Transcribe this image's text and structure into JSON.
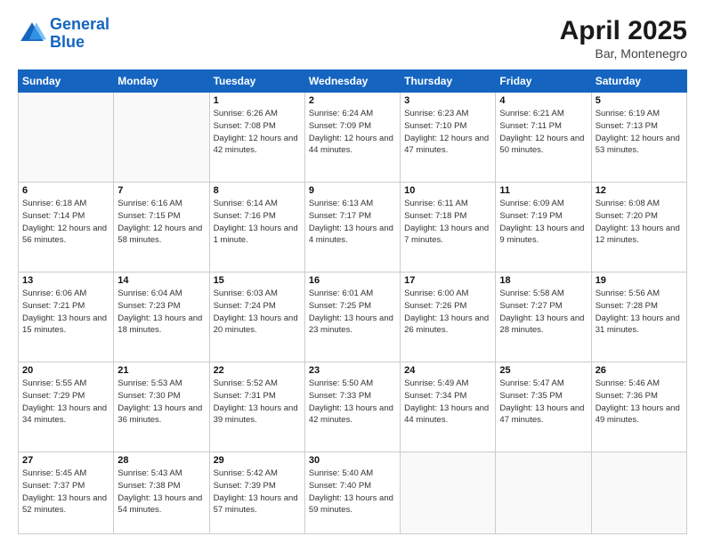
{
  "header": {
    "logo_general": "General",
    "logo_blue": "Blue",
    "month": "April 2025",
    "location": "Bar, Montenegro"
  },
  "weekdays": [
    "Sunday",
    "Monday",
    "Tuesday",
    "Wednesday",
    "Thursday",
    "Friday",
    "Saturday"
  ],
  "weeks": [
    [
      {
        "day": "",
        "sunrise": "",
        "sunset": "",
        "daylight": ""
      },
      {
        "day": "",
        "sunrise": "",
        "sunset": "",
        "daylight": ""
      },
      {
        "day": "1",
        "sunrise": "Sunrise: 6:26 AM",
        "sunset": "Sunset: 7:08 PM",
        "daylight": "Daylight: 12 hours and 42 minutes."
      },
      {
        "day": "2",
        "sunrise": "Sunrise: 6:24 AM",
        "sunset": "Sunset: 7:09 PM",
        "daylight": "Daylight: 12 hours and 44 minutes."
      },
      {
        "day": "3",
        "sunrise": "Sunrise: 6:23 AM",
        "sunset": "Sunset: 7:10 PM",
        "daylight": "Daylight: 12 hours and 47 minutes."
      },
      {
        "day": "4",
        "sunrise": "Sunrise: 6:21 AM",
        "sunset": "Sunset: 7:11 PM",
        "daylight": "Daylight: 12 hours and 50 minutes."
      },
      {
        "day": "5",
        "sunrise": "Sunrise: 6:19 AM",
        "sunset": "Sunset: 7:13 PM",
        "daylight": "Daylight: 12 hours and 53 minutes."
      }
    ],
    [
      {
        "day": "6",
        "sunrise": "Sunrise: 6:18 AM",
        "sunset": "Sunset: 7:14 PM",
        "daylight": "Daylight: 12 hours and 56 minutes."
      },
      {
        "day": "7",
        "sunrise": "Sunrise: 6:16 AM",
        "sunset": "Sunset: 7:15 PM",
        "daylight": "Daylight: 12 hours and 58 minutes."
      },
      {
        "day": "8",
        "sunrise": "Sunrise: 6:14 AM",
        "sunset": "Sunset: 7:16 PM",
        "daylight": "Daylight: 13 hours and 1 minute."
      },
      {
        "day": "9",
        "sunrise": "Sunrise: 6:13 AM",
        "sunset": "Sunset: 7:17 PM",
        "daylight": "Daylight: 13 hours and 4 minutes."
      },
      {
        "day": "10",
        "sunrise": "Sunrise: 6:11 AM",
        "sunset": "Sunset: 7:18 PM",
        "daylight": "Daylight: 13 hours and 7 minutes."
      },
      {
        "day": "11",
        "sunrise": "Sunrise: 6:09 AM",
        "sunset": "Sunset: 7:19 PM",
        "daylight": "Daylight: 13 hours and 9 minutes."
      },
      {
        "day": "12",
        "sunrise": "Sunrise: 6:08 AM",
        "sunset": "Sunset: 7:20 PM",
        "daylight": "Daylight: 13 hours and 12 minutes."
      }
    ],
    [
      {
        "day": "13",
        "sunrise": "Sunrise: 6:06 AM",
        "sunset": "Sunset: 7:21 PM",
        "daylight": "Daylight: 13 hours and 15 minutes."
      },
      {
        "day": "14",
        "sunrise": "Sunrise: 6:04 AM",
        "sunset": "Sunset: 7:23 PM",
        "daylight": "Daylight: 13 hours and 18 minutes."
      },
      {
        "day": "15",
        "sunrise": "Sunrise: 6:03 AM",
        "sunset": "Sunset: 7:24 PM",
        "daylight": "Daylight: 13 hours and 20 minutes."
      },
      {
        "day": "16",
        "sunrise": "Sunrise: 6:01 AM",
        "sunset": "Sunset: 7:25 PM",
        "daylight": "Daylight: 13 hours and 23 minutes."
      },
      {
        "day": "17",
        "sunrise": "Sunrise: 6:00 AM",
        "sunset": "Sunset: 7:26 PM",
        "daylight": "Daylight: 13 hours and 26 minutes."
      },
      {
        "day": "18",
        "sunrise": "Sunrise: 5:58 AM",
        "sunset": "Sunset: 7:27 PM",
        "daylight": "Daylight: 13 hours and 28 minutes."
      },
      {
        "day": "19",
        "sunrise": "Sunrise: 5:56 AM",
        "sunset": "Sunset: 7:28 PM",
        "daylight": "Daylight: 13 hours and 31 minutes."
      }
    ],
    [
      {
        "day": "20",
        "sunrise": "Sunrise: 5:55 AM",
        "sunset": "Sunset: 7:29 PM",
        "daylight": "Daylight: 13 hours and 34 minutes."
      },
      {
        "day": "21",
        "sunrise": "Sunrise: 5:53 AM",
        "sunset": "Sunset: 7:30 PM",
        "daylight": "Daylight: 13 hours and 36 minutes."
      },
      {
        "day": "22",
        "sunrise": "Sunrise: 5:52 AM",
        "sunset": "Sunset: 7:31 PM",
        "daylight": "Daylight: 13 hours and 39 minutes."
      },
      {
        "day": "23",
        "sunrise": "Sunrise: 5:50 AM",
        "sunset": "Sunset: 7:33 PM",
        "daylight": "Daylight: 13 hours and 42 minutes."
      },
      {
        "day": "24",
        "sunrise": "Sunrise: 5:49 AM",
        "sunset": "Sunset: 7:34 PM",
        "daylight": "Daylight: 13 hours and 44 minutes."
      },
      {
        "day": "25",
        "sunrise": "Sunrise: 5:47 AM",
        "sunset": "Sunset: 7:35 PM",
        "daylight": "Daylight: 13 hours and 47 minutes."
      },
      {
        "day": "26",
        "sunrise": "Sunrise: 5:46 AM",
        "sunset": "Sunset: 7:36 PM",
        "daylight": "Daylight: 13 hours and 49 minutes."
      }
    ],
    [
      {
        "day": "27",
        "sunrise": "Sunrise: 5:45 AM",
        "sunset": "Sunset: 7:37 PM",
        "daylight": "Daylight: 13 hours and 52 minutes."
      },
      {
        "day": "28",
        "sunrise": "Sunrise: 5:43 AM",
        "sunset": "Sunset: 7:38 PM",
        "daylight": "Daylight: 13 hours and 54 minutes."
      },
      {
        "day": "29",
        "sunrise": "Sunrise: 5:42 AM",
        "sunset": "Sunset: 7:39 PM",
        "daylight": "Daylight: 13 hours and 57 minutes."
      },
      {
        "day": "30",
        "sunrise": "Sunrise: 5:40 AM",
        "sunset": "Sunset: 7:40 PM",
        "daylight": "Daylight: 13 hours and 59 minutes."
      },
      {
        "day": "",
        "sunrise": "",
        "sunset": "",
        "daylight": ""
      },
      {
        "day": "",
        "sunrise": "",
        "sunset": "",
        "daylight": ""
      },
      {
        "day": "",
        "sunrise": "",
        "sunset": "",
        "daylight": ""
      }
    ]
  ]
}
